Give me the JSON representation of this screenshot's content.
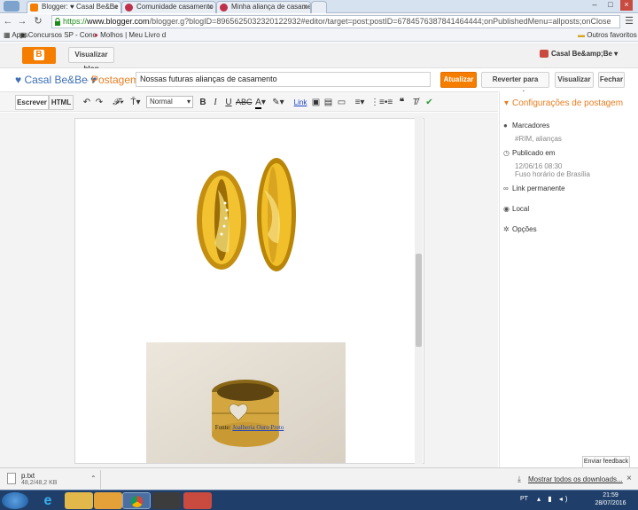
{
  "browser": {
    "tabs": [
      {
        "label": "Blogger: ♥ Casal Be&Be ♥",
        "active": true
      },
      {
        "label": "Comunidade casamento",
        "active": false
      },
      {
        "label": "Minha aliança de casame",
        "active": false
      }
    ],
    "url_scheme": "https://",
    "url_host": "www.blogger.com",
    "url_path": "/blogger.g?blogID=8965625032320122932#editor/target=post;postID=6784576387841464444;onPublishedMenu=allposts;onClose",
    "bookmarks": [
      {
        "label": "Apps"
      },
      {
        "label": "Concursos SP - Conc"
      },
      {
        "label": "Molhos | Meu Livro d"
      },
      {
        "label": "Outros favoritos"
      }
    ]
  },
  "blogger": {
    "visualizar_blog": "Visualizar blog",
    "account_name": "Casal Be&amp;Be",
    "blog_name": "♥ Casal Be&Be ♥",
    "separator": "·",
    "post_label": "Postagem",
    "post_title": "Nossas futuras alianças de casamento",
    "buttons": {
      "update": "Atualizar",
      "revert": "Reverter para rascunho",
      "preview": "Visualizar",
      "close": "Fechar"
    }
  },
  "toolbar": {
    "compose": "Escrever",
    "html": "HTML",
    "font_size": "Normal",
    "link": "Link"
  },
  "editor": {
    "caption_prefix": "Fonte: ",
    "caption_link": "Joalheria Ouro Preto"
  },
  "sidebar": {
    "title": "Configurações de postagem",
    "labels_heading": "Marcadores",
    "labels_value": "#RIM, alianças",
    "published_heading": "Publicado em",
    "published_datetime": "12/06/16 08:30",
    "timezone": "Fuso horário de Brasília",
    "permalink": "Link permanente",
    "location": "Local",
    "options": "Opções",
    "feedback": "Enviar feedback"
  },
  "downloads": {
    "filename": "p.txt",
    "size": "48,2/48,2 KB",
    "show_all": "Mostrar todos os downloads..."
  },
  "taskbar": {
    "lang": "PT",
    "time": "21:59",
    "date": "28/07/2016"
  },
  "colors": {
    "blogger_orange": "#f57d00",
    "link_blue": "#3d6fb6",
    "gold": "#d4a017"
  }
}
